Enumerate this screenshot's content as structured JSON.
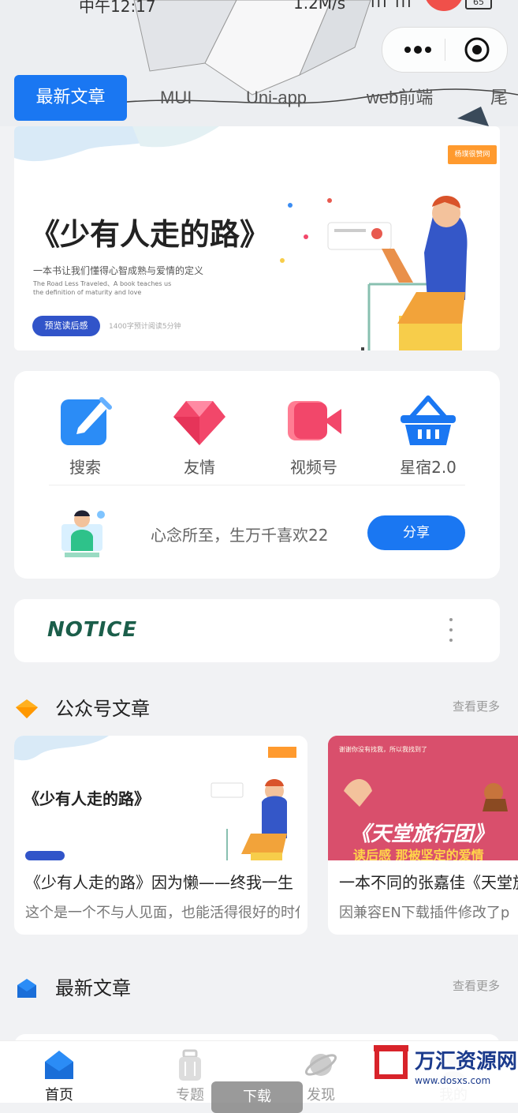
{
  "status_bar": {
    "time": "中午12:17",
    "network_speed": "1.2M/s",
    "battery": "65"
  },
  "tabs": [
    {
      "label": "最新文章"
    },
    {
      "label": "MUI"
    },
    {
      "label": "Uni-app"
    },
    {
      "label": "web前端"
    },
    {
      "label": "尾"
    }
  ],
  "banner": {
    "tag": "杨璞很赞网",
    "title": "《少有人走的路》",
    "subtitle": "一本书让我们懂得心智成熟与爱情的定义",
    "english": "The Road Less Traveled、A book teaches us the definition of maturity and love",
    "button": "预览读后感",
    "read_time": "1400字预计阅读5分钟"
  },
  "quick_entries": [
    {
      "label": "搜索",
      "icon": "edit-icon",
      "color": "#2b8cf6"
    },
    {
      "label": "友情",
      "icon": "diamond-icon",
      "color": "#f2476a"
    },
    {
      "label": "视频号",
      "icon": "video-icon",
      "color": "#f2476a"
    },
    {
      "label": "星宿2.0",
      "icon": "basket-icon",
      "color": "#1a77f2"
    }
  ],
  "share_row": {
    "slogan": "心念所至，生万千喜欢22",
    "button": "分享"
  },
  "notice": {
    "label": "NOTICE"
  },
  "sections": {
    "wechat": {
      "title": "公众号文章",
      "more": "查看更多"
    },
    "latest": {
      "title": "最新文章",
      "more": "查看更多"
    }
  },
  "articles": [
    {
      "thumb_title": "《少有人走的路》",
      "title": "《少有人走的路》因为懒——终我一生",
      "desc": "这个是一个不与人见面，也能活得很好的时代"
    },
    {
      "thumb_title": "《天堂旅行团》",
      "thumb_sub": "读后感  那被坚定的爱情",
      "thumb_top": "谢谢你没有找我，所以我找到了",
      "title": "一本不同的张嘉佳《天堂旅行团》",
      "desc": "因兼容EN下载插件修改了p"
    }
  ],
  "tabbar": [
    {
      "label": "首页",
      "icon": "home-icon"
    },
    {
      "label": "专题",
      "icon": "luggage-icon"
    },
    {
      "label": "发现",
      "icon": "planet-icon"
    },
    {
      "label": "我的",
      "icon": "user-icon"
    }
  ],
  "overlay": {
    "download": "下载",
    "watermark_text": "万汇资源网",
    "watermark_url": "www.dosxs.com"
  },
  "colors": {
    "primary": "#1a77f2",
    "page_bg": "#f1f2f4"
  }
}
